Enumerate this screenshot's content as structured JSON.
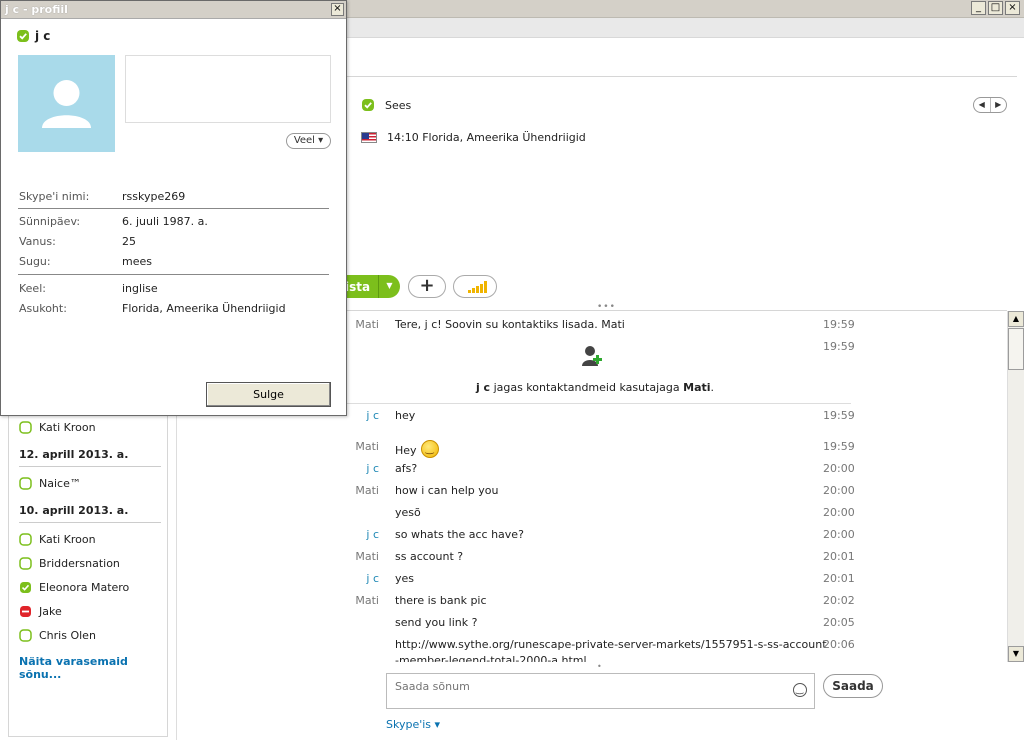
{
  "window": {
    "minimize": "_",
    "maximize": "□",
    "close": "×"
  },
  "header": {
    "status_text": "Sees",
    "location_text": "14:10 Florida, Ameerika Ühendriigid",
    "nav_left": "◀",
    "nav_right": "▶"
  },
  "actions": {
    "call_label": "ista",
    "call_dropdown": "▼",
    "add_label": "+"
  },
  "chat": {
    "messages": [
      {
        "who": "Mati",
        "text": "Tere, j c! Soovin su kontaktiks lisada.  Mati",
        "time": "19:59"
      },
      {
        "who": "",
        "text": "",
        "time": "19:59"
      },
      {
        "who": "j c",
        "text": "hey",
        "time": "19:59"
      },
      {
        "who": "Mati",
        "text": "Hey",
        "time": "19:59"
      },
      {
        "who": "j c",
        "text": "afs?",
        "time": "20:00"
      },
      {
        "who": "Mati",
        "text": "how i can help you",
        "time": "20:00"
      },
      {
        "who": "",
        "text": "yesõ",
        "time": "20:00"
      },
      {
        "who": "j c",
        "text": "so whats the acc have?",
        "time": "20:00"
      },
      {
        "who": "Mati",
        "text": "ss account ?",
        "time": "20:01"
      },
      {
        "who": "j c",
        "text": "yes",
        "time": "20:01"
      },
      {
        "who": "Mati",
        "text": "there is bank pic",
        "time": "20:02"
      },
      {
        "who": "",
        "text": "send you link ?",
        "time": "20:05"
      },
      {
        "who": "",
        "text": "http://www.sythe.org/runescape-private-server-markets/1557951-s-ss-account",
        "time": "20:06"
      },
      {
        "who": "",
        "text": "-member-legend-total-2000-a.html",
        "time": ""
      }
    ],
    "share_name": "j c",
    "share_text": "jagas kontaktandmeid kasutajaga",
    "share_target": "Mati"
  },
  "compose": {
    "placeholder": "Saada sõnum",
    "send_label": "Saada",
    "via_label": "Skype'is ▾"
  },
  "contacts": {
    "items": [
      {
        "name": "Kati Kroon",
        "status": "online-outline"
      },
      {
        "name": "Naice™",
        "status": "online-outline"
      },
      {
        "name": "Kati Kroon",
        "status": "online-outline"
      },
      {
        "name": "Briddersnation",
        "status": "online-outline"
      },
      {
        "name": "Eleonora Matero",
        "status": "online"
      },
      {
        "name": "Jake",
        "status": "busy"
      },
      {
        "name": "Chris Olen",
        "status": "online-outline"
      }
    ],
    "date_1": "12. aprill 2013. a.",
    "date_2": "10. aprill 2013. a.",
    "more_link": "Näita varasemaid sõnu..."
  },
  "profile": {
    "title": "j c - profiil",
    "close_x": "×",
    "name": "j c",
    "more_btn": "Veel ▾",
    "skype_name_label": "Skype'i nimi:",
    "skype_name": "rsskype269",
    "birthday_label": "Sünnipäev:",
    "birthday": "6. juuli 1987. a.",
    "age_label": "Vanus:",
    "age": "25",
    "gender_label": "Sugu:",
    "gender": "mees",
    "language_label": "Keel:",
    "language": "inglise",
    "location_label": "Asukoht:",
    "location": "Florida, Ameerika Ühendriigid",
    "close_label": "Sulge"
  },
  "colors": {
    "accent_green": "#7cbf1c",
    "link_blue": "#0a72b0",
    "avatar_bg": "#a9daea",
    "busy_red": "#e0242a"
  }
}
